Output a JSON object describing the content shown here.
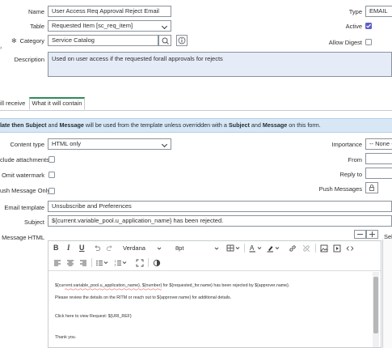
{
  "form": {
    "name_label": "Name",
    "name_value": "User Access Req Approval Reject Email",
    "table_label": "Table",
    "table_value": "Requested Item [sc_req_item]",
    "category_label": "Category",
    "category_value": "Service Catalog",
    "description_label": "Description",
    "description_value": "Used on user access if the requested forall approvals for rejects",
    "type_label": "Type",
    "type_value": "EMAIL",
    "active_label": "Active",
    "active_checked": true,
    "allow_digest_label": "Allow Digest",
    "allow_digest_checked": false,
    "mandatory_mark": "✻"
  },
  "tabs": [
    {
      "label": "ill receive",
      "active": false
    },
    {
      "label": "What it will contain",
      "active": true
    }
  ],
  "info_banner": {
    "p1": "late then ",
    "b1": "Subject",
    "p2": " and ",
    "b2": "Message",
    "p3": " will be used from the template unless overridden with a ",
    "b3": "Subject",
    "p4": " and ",
    "b4": "Message",
    "p5": " on this form."
  },
  "content": {
    "content_type_label": "Content type",
    "content_type_value": "HTML only",
    "include_attachments_label": "clude attachments",
    "omit_watermark_label": "Omit watermark",
    "push_message_only_label": "ush Message Only",
    "importance_label": "Importance",
    "importance_value": "-- None --",
    "from_label": "From",
    "reply_to_label": "Reply to",
    "push_messages_label": "Push Messages",
    "email_template_label": "Email template",
    "email_template_value": "Unsubscribe and Preferences",
    "subject_label": "Subject",
    "subject_value": "${current.variable_pool.u_application_name} has been rejected.",
    "message_html_label": "Message HTML",
    "sel_label": "Sel"
  },
  "editor": {
    "font_family": "Verdana",
    "font_size": "8pt",
    "line1": "${current.variable_pool.u_application_name}, ${number} for ${requested_for.name} has been rejected by ${approver.name}.",
    "line2": "Please review the details on the RITM or reach out to ${approver.name} for additional details.",
    "line3": "Click here to view Request: ${URI_REF}",
    "line4": "Thank you."
  }
}
